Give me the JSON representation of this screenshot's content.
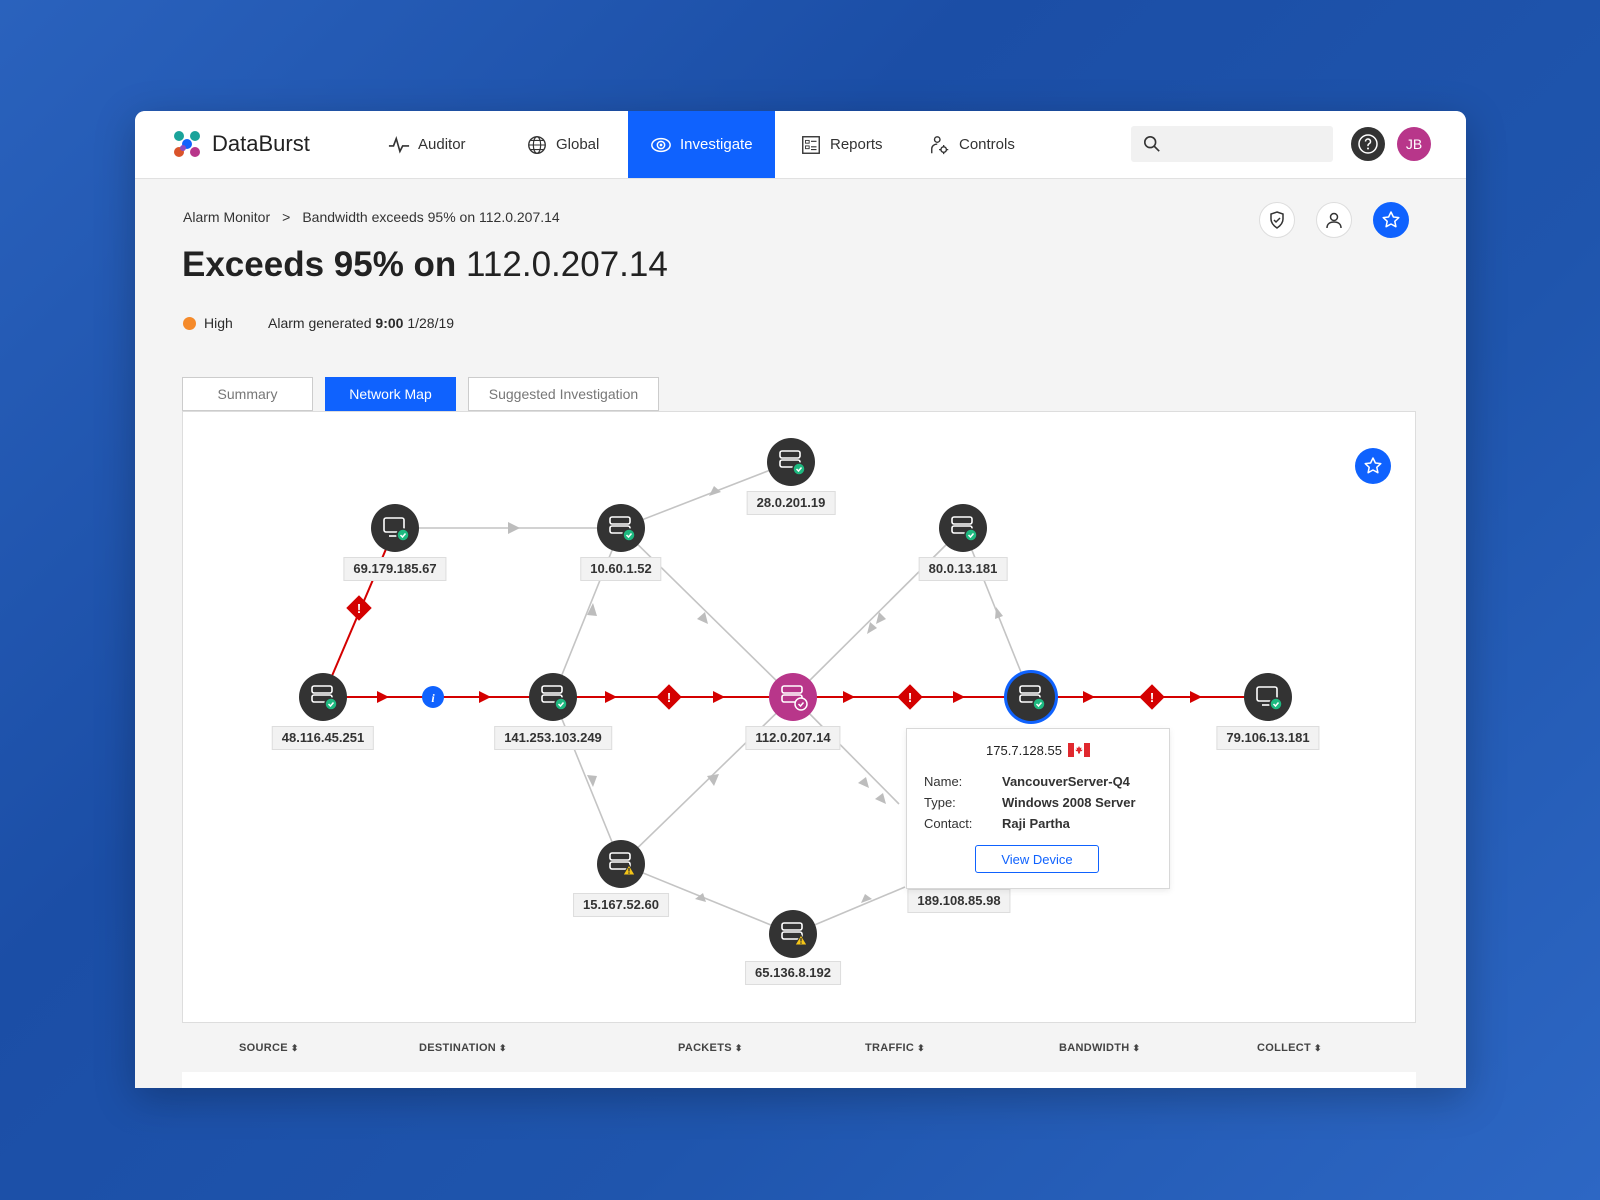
{
  "app": {
    "brand": "DataBurst"
  },
  "nav": [
    {
      "label": "Auditor",
      "icon": "pulse-icon"
    },
    {
      "label": "Global",
      "icon": "globe-icon"
    },
    {
      "label": "Investigate",
      "icon": "eye-icon",
      "active": true
    },
    {
      "label": "Reports",
      "icon": "reports-icon"
    },
    {
      "label": "Controls",
      "icon": "controls-icon"
    }
  ],
  "search": {
    "placeholder": ""
  },
  "user": {
    "initials": "JB"
  },
  "breadcrumb": {
    "parent": "Alarm Monitor",
    "separator": ">",
    "current": "Bandwidth exceeds 95% on 112.0.207.14"
  },
  "page": {
    "title_bold": "Exceeds 95% on",
    "title_ip": "112.0.207.14",
    "severity": "High",
    "alarm_prefix": "Alarm generated",
    "alarm_time": "9:00",
    "alarm_date": "1/28/19"
  },
  "tabs": [
    "Summary",
    "Network Map",
    "Suggested Investigation"
  ],
  "active_tab": "Network Map",
  "network": {
    "nodes": [
      {
        "id": "28.0.201.19",
        "type": "server",
        "status": "ok"
      },
      {
        "id": "69.179.185.67",
        "type": "workstation",
        "status": "ok"
      },
      {
        "id": "10.60.1.52",
        "type": "server",
        "status": "ok"
      },
      {
        "id": "80.0.13.181",
        "type": "server",
        "status": "ok"
      },
      {
        "id": "48.116.45.251",
        "type": "server",
        "status": "ok"
      },
      {
        "id": "141.253.103.249",
        "type": "server",
        "status": "ok"
      },
      {
        "id": "112.0.207.14",
        "type": "server",
        "status": "ok",
        "focus": true
      },
      {
        "id": "175.7.128.55",
        "type": "server",
        "status": "ok",
        "selected": true
      },
      {
        "id": "79.106.13.181",
        "type": "workstation",
        "status": "ok"
      },
      {
        "id": "15.167.52.60",
        "type": "server",
        "status": "warning"
      },
      {
        "id": "65.136.8.192",
        "type": "server",
        "status": "warning"
      },
      {
        "id": "189.108.85.98",
        "type": "server",
        "status": "ok"
      }
    ],
    "colors": {
      "alarm": "#d40000",
      "normal": "#bdbdbd",
      "focus": "#b8368a",
      "accent": "#0f62fe",
      "ok": "#1eb980",
      "warning": "#f5c518"
    }
  },
  "tooltip": {
    "ip": "175.7.128.55",
    "flag": "canada-flag",
    "name_label": "Name:",
    "name": "VancouverServer-Q4",
    "type_label": "Type:",
    "type": "Windows 2008 Server",
    "contact_label": "Contact:",
    "contact": "Raji Partha",
    "button": "View Device"
  },
  "table": {
    "columns": [
      "SOURCE",
      "DESTINATION",
      "PACKETS",
      "TRAFFIC",
      "BANDWIDTH",
      "COLLECT"
    ]
  }
}
